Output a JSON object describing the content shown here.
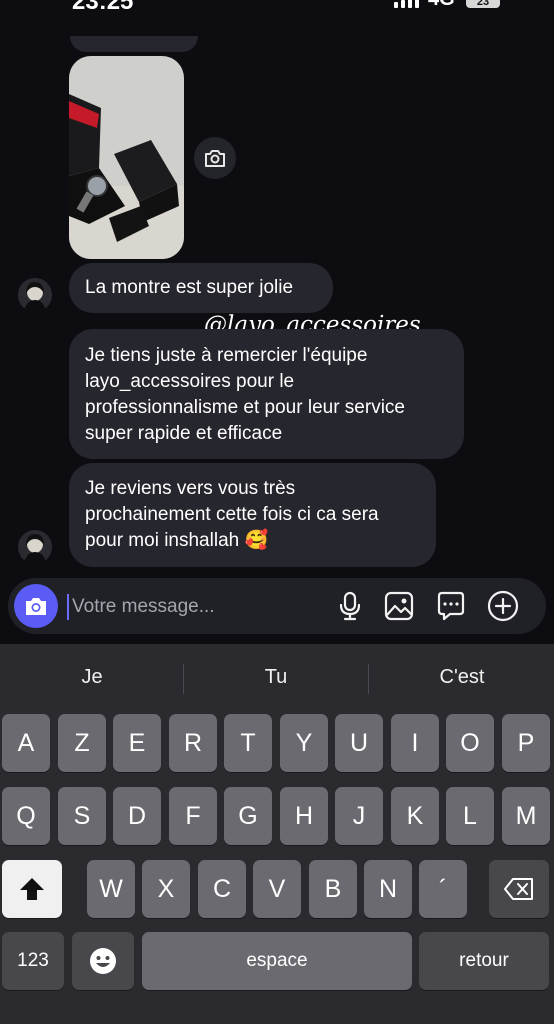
{
  "status_bar": {
    "time": "23:25",
    "network": "4G",
    "battery": "23"
  },
  "chat": {
    "messages": [
      {
        "text": "La montre est super jolie"
      },
      {
        "text": "Je tiens juste à remercier l'équipe layo_accessoires pour le professionnalisme et pour leur service super rapide et efficace"
      },
      {
        "text": "Je reviens vers vous très prochainement cette fois ci ca sera pour moi inshallah 🥰"
      }
    ],
    "watermark": "@layo_accessoires"
  },
  "composer": {
    "placeholder": "Votre message...",
    "icons": [
      "camera-icon",
      "microphone-icon",
      "gallery-icon",
      "sticker-icon",
      "plus-icon"
    ],
    "accent_color": "#5a5cf5"
  },
  "keyboard": {
    "suggestions": [
      "Je",
      "Tu",
      "C'est"
    ],
    "row1": [
      "A",
      "Z",
      "E",
      "R",
      "T",
      "Y",
      "U",
      "I",
      "O",
      "P"
    ],
    "row2": [
      "Q",
      "S",
      "D",
      "F",
      "G",
      "H",
      "J",
      "K",
      "L",
      "M"
    ],
    "row3": [
      "W",
      "X",
      "C",
      "V",
      "B",
      "N",
      "´"
    ],
    "numbers_label": "123",
    "space_label": "espace",
    "return_label": "retour",
    "icons": [
      "shift-icon",
      "backspace-icon",
      "emoji-icon"
    ]
  }
}
